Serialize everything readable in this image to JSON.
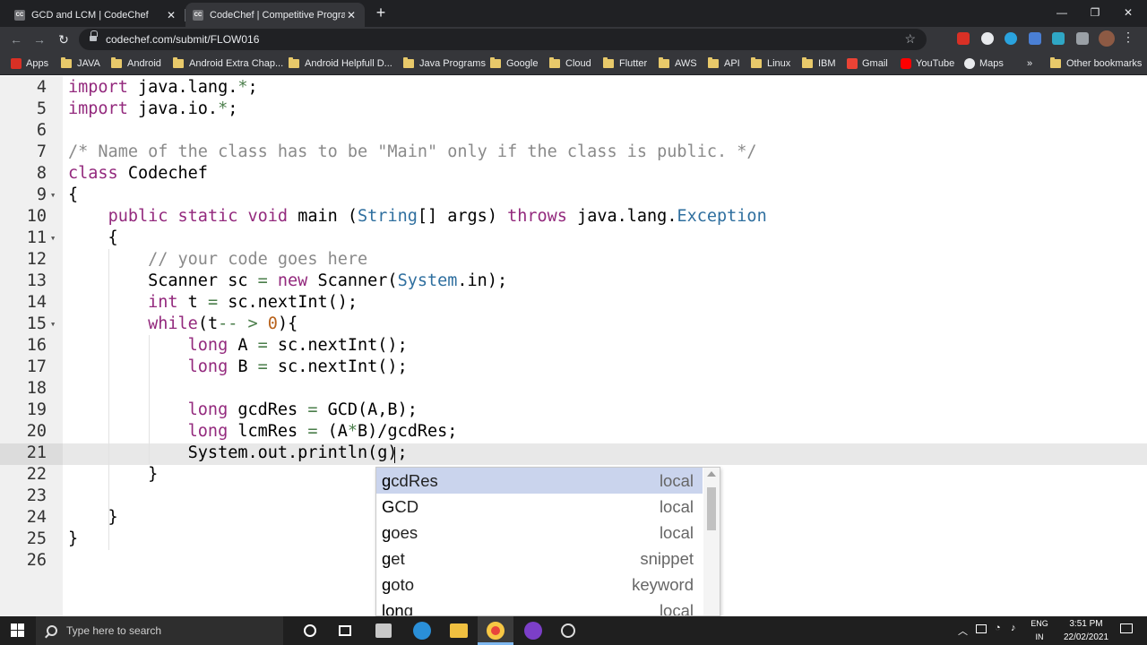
{
  "browser": {
    "tabs": [
      {
        "favicon": "CC",
        "title": "GCD and LCM | CodeChef",
        "active": false
      },
      {
        "favicon": "CC",
        "title": "CodeChef | Competitive Programm",
        "active": true
      }
    ],
    "url": "codechef.com/submit/FLOW016",
    "bookmarks": [
      "Apps",
      "JAVA",
      "Android",
      "Android Extra Chap...",
      "Android Helpfull D...",
      "Java Programs",
      "Google",
      "Cloud",
      "Flutter",
      "AWS",
      "API",
      "Linux",
      "IBM",
      "Gmail",
      "YouTube",
      "Maps"
    ],
    "more_bookmarks": "»",
    "other_bookmarks": "Other bookmarks"
  },
  "editor": {
    "lines": [
      {
        "num": "4",
        "text": "import java.lang.*;"
      },
      {
        "num": "5",
        "text": "import java.io.*;"
      },
      {
        "num": "6",
        "text": ""
      },
      {
        "num": "7",
        "text": "/* Name of the class has to be \"Main\" only if the class is public. */"
      },
      {
        "num": "8",
        "text": "class Codechef"
      },
      {
        "num": "9",
        "text": "{"
      },
      {
        "num": "10",
        "text": "    public static void main (String[] args) throws java.lang.Exception"
      },
      {
        "num": "11",
        "text": "    {"
      },
      {
        "num": "12",
        "text": "        // your code goes here"
      },
      {
        "num": "13",
        "text": "        Scanner sc = new Scanner(System.in);"
      },
      {
        "num": "14",
        "text": "        int t = sc.nextInt();"
      },
      {
        "num": "15",
        "text": "        while(t-- > 0){"
      },
      {
        "num": "16",
        "text": "            long A = sc.nextInt();"
      },
      {
        "num": "17",
        "text": "            long B = sc.nextInt();"
      },
      {
        "num": "18",
        "text": ""
      },
      {
        "num": "19",
        "text": "            long gcdRes = GCD(A,B);"
      },
      {
        "num": "20",
        "text": "            long lcmRes = (A*B)/gcdRes;"
      },
      {
        "num": "21",
        "text": "            System.out.println(g);"
      },
      {
        "num": "22",
        "text": "        }"
      },
      {
        "num": "23",
        "text": ""
      },
      {
        "num": "24",
        "text": "    }"
      },
      {
        "num": "25",
        "text": "}"
      },
      {
        "num": "26",
        "text": ""
      }
    ],
    "autocomplete": [
      {
        "match": "g",
        "rest": "cdRes",
        "type": "local"
      },
      {
        "match": "G",
        "rest": "CD",
        "type": "local"
      },
      {
        "match": "g",
        "rest": "oes",
        "type": "local"
      },
      {
        "match": "g",
        "rest": "et",
        "type": "snippet"
      },
      {
        "match": "g",
        "rest": "oto",
        "type": "keyword"
      },
      {
        "match": "lon",
        "rest": "g",
        "type": "local"
      }
    ]
  },
  "taskbar": {
    "search_placeholder": "Type here to search",
    "language": "ENG",
    "region": "IN",
    "time": "3:51 PM",
    "date": "22/02/2021"
  },
  "colors": {
    "keyword": "#93297d",
    "class": "#2f6f9f",
    "comment": "#8a8a8a",
    "number": "#b8621b",
    "selection": "#cad4ed"
  }
}
